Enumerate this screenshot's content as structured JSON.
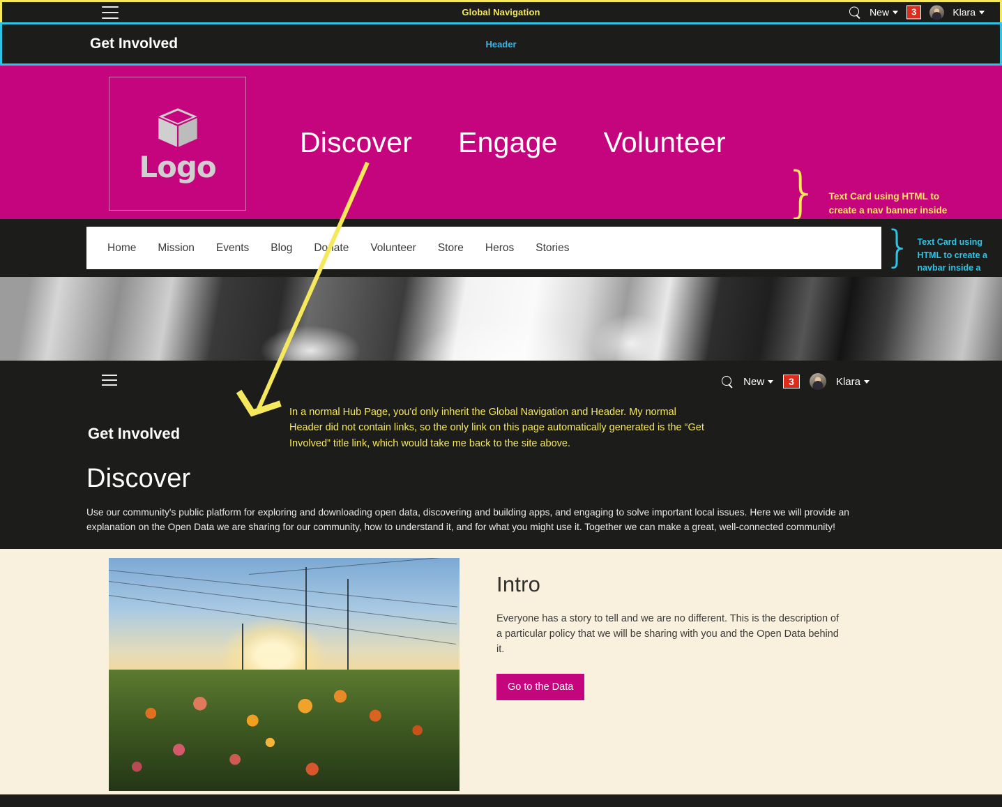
{
  "global_nav": {
    "menu_icon": "hamburger-icon",
    "title": "Global Navigation",
    "search_icon": "search-icon",
    "new_label": "New",
    "badge_count": "3",
    "user_name": "Klara",
    "border_color": "#f5e85c"
  },
  "header": {
    "site_title": "Get Involved",
    "label": "Header",
    "border_color": "#2ec4e6",
    "label_color": "#3bb4e8"
  },
  "pink_row": {
    "background": "#c5057e",
    "logo_text": "Logo",
    "logo_icon": "cube-icon",
    "links": [
      "Discover",
      "Engage",
      "Volunteer"
    ],
    "annotation": "Text Card using HTML to create a nav banner inside a pink Row Card",
    "annotation_color": "#f5e85c",
    "brace": "}"
  },
  "black_row": {
    "background": "#1c1c1b",
    "navbar_items": [
      "Home",
      "Mission",
      "Events",
      "Blog",
      "Donate",
      "Volunteer",
      "Store",
      "Heros",
      "Stories"
    ],
    "annotation": "Text Card using HTML to create a navbar inside a black Row Card",
    "annotation_color": "#2ec4e6",
    "brace": "}"
  },
  "hub_page": {
    "menu_icon": "hamburger-icon",
    "search_icon": "search-icon",
    "new_label": "New",
    "badge_count": "3",
    "user_name": "Klara",
    "site_title": "Get Involved",
    "heading": "Discover",
    "body": "Use our community's public platform for exploring and downloading open data, discovering and building apps, and engaging to solve important local issues. Here we will provide an explanation on the Open Data we are sharing for our community, how to understand it, and for what you might use it. Together we can make a great, well-connected community!",
    "annotation": "In a normal Hub Page, you'd only inherit the Global Navigation and Header. My normal Header did not contain links, so the only link on this page automatically generated is the “Get Involved” title link, which would take me back to the site above.",
    "annotation_color": "#f5e85c"
  },
  "intro": {
    "background": "#f9f0de",
    "heading": "Intro",
    "body": "Everyone has a story to tell and we are no different. This is the description of a particular policy that we will be sharing with you and the Open Data behind it.",
    "cta_label": "Go to the Data",
    "cta_color": "#c5057e",
    "image_alt": "sunset-flower-garden-photo"
  }
}
